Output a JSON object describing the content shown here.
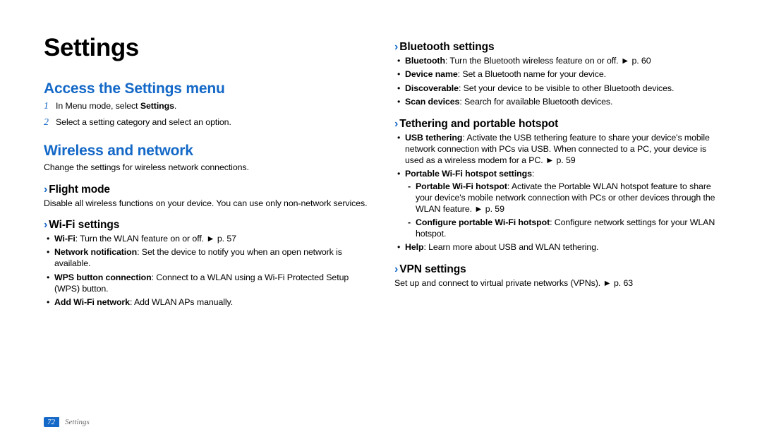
{
  "title": "Settings",
  "left": {
    "section1_heading": "Access the Settings menu",
    "step1_pre": "In Menu mode, select ",
    "step1_bold": "Settings",
    "step1_post": ".",
    "step2": "Select a setting category and select an option.",
    "section2_heading": "Wireless and network",
    "section2_intro": "Change the settings for wireless network connections.",
    "flight_heading": "Flight mode",
    "flight_body": "Disable all wireless functions on your device. You can use only non-network services.",
    "wifi_heading": "Wi-Fi settings",
    "wifi_items": {
      "i1_b": "Wi-Fi",
      "i1_t": ": Turn the WLAN feature on or off. ► p. 57",
      "i2_b": "Network notification",
      "i2_t": ": Set the device to notify you when an open network is available.",
      "i3_b": "WPS button connection",
      "i3_t": ": Connect to a WLAN using a Wi-Fi Protected Setup (WPS) button.",
      "i4_b": "Add Wi-Fi network",
      "i4_t": ": Add WLAN APs manually."
    }
  },
  "right": {
    "bt_heading": "Bluetooth settings",
    "bt_items": {
      "i1_b": "Bluetooth",
      "i1_t": ": Turn the Bluetooth wireless feature on or off. ► p. 60",
      "i2_b": "Device name",
      "i2_t": ": Set a Bluetooth name for your device.",
      "i3_b": "Discoverable",
      "i3_t": ": Set your device to be visible to other Bluetooth devices.",
      "i4_b": "Scan devices",
      "i4_t": ": Search for available Bluetooth devices."
    },
    "teth_heading": "Tethering and portable hotspot",
    "teth_i1_b": "USB tethering",
    "teth_i1_t": ": Activate the USB tethering feature to share your device's mobile network connection with PCs via USB. When connected to a PC, your device is used as a wireless modem for a PC. ► p. 59",
    "teth_i2_b": "Portable Wi-Fi hotspot settings",
    "teth_i2_t": ":",
    "teth_sub": {
      "s1_b": "Portable Wi-Fi hotspot",
      "s1_t": ": Activate the Portable WLAN hotspot feature to share your device's mobile network connection with PCs or other devices through the WLAN feature. ► p. 59",
      "s2_b": "Configure portable Wi-Fi hotspot",
      "s2_t": ": Configure network settings for your WLAN hotspot."
    },
    "teth_i3_b": "Help",
    "teth_i3_t": ": Learn more about USB and WLAN tethering.",
    "vpn_heading": "VPN settings",
    "vpn_body": "Set up and connect to virtual private networks (VPNs). ► p. 63"
  },
  "footer": {
    "page_num": "72",
    "section_name": "Settings"
  }
}
